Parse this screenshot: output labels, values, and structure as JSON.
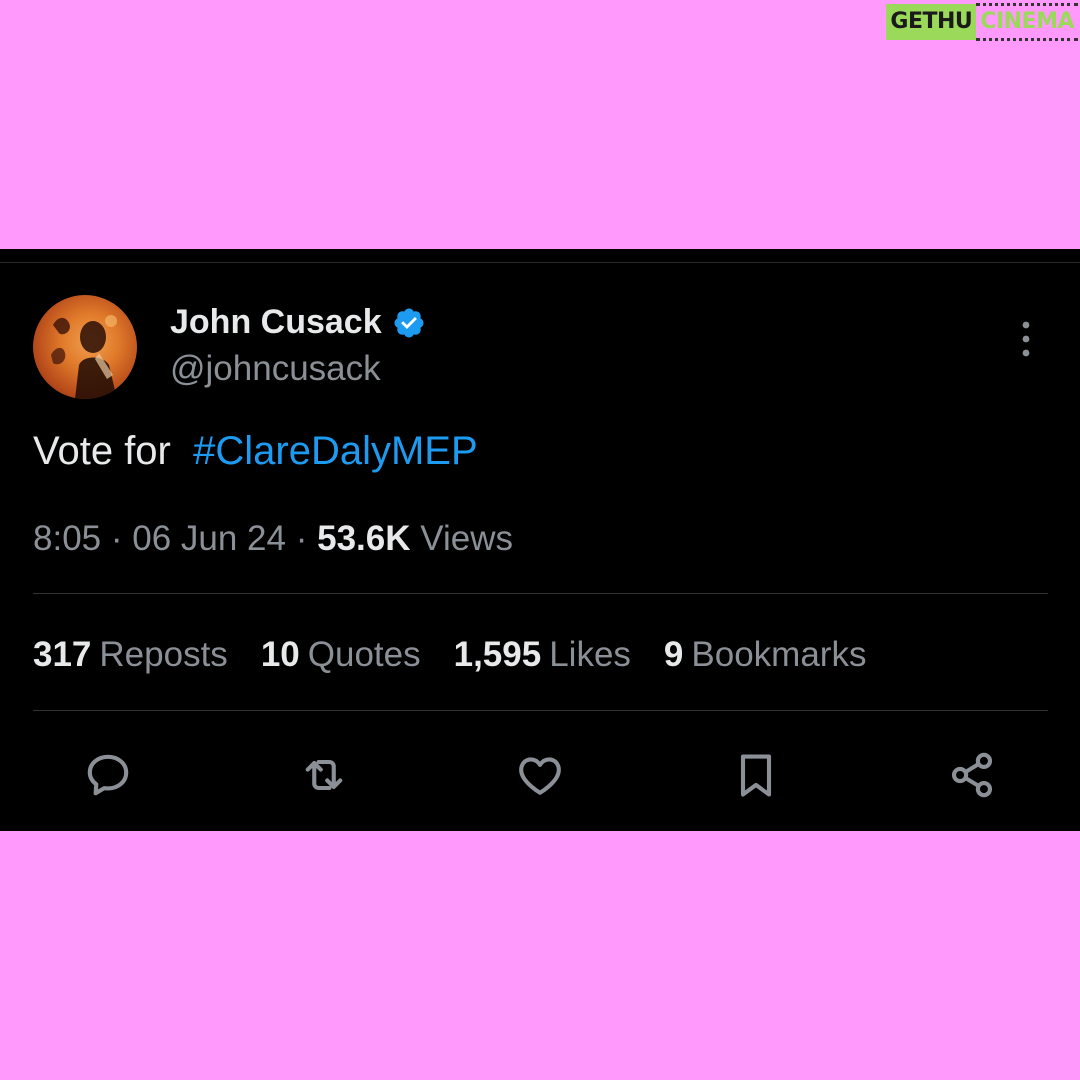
{
  "watermark": {
    "part1": "GETHU",
    "part2": "CINEMA"
  },
  "tweet": {
    "display_name": "John Cusack",
    "handle": "@johncusack",
    "text_prefix": "Vote for",
    "hashtag": "#ClareDalyMEP",
    "time": "8:05",
    "date": "06 Jun 24",
    "views_count": "53.6K",
    "views_label": "Views",
    "separator": "·"
  },
  "stats": [
    {
      "count": "317",
      "label": "Reposts"
    },
    {
      "count": "10",
      "label": "Quotes"
    },
    {
      "count": "1,595",
      "label": "Likes"
    },
    {
      "count": "9",
      "label": "Bookmarks"
    }
  ],
  "icons": {
    "reply": "reply-icon",
    "repost": "repost-icon",
    "like": "like-icon",
    "bookmark": "bookmark-icon",
    "share": "share-icon",
    "verified": "verified-icon",
    "more": "more-icon"
  },
  "colors": {
    "page_background": "#ff99fb",
    "card_background": "#000000",
    "hashtag": "#1d9bf0",
    "verified_badge": "#1d9bf0",
    "watermark_green": "#9bd95a"
  }
}
